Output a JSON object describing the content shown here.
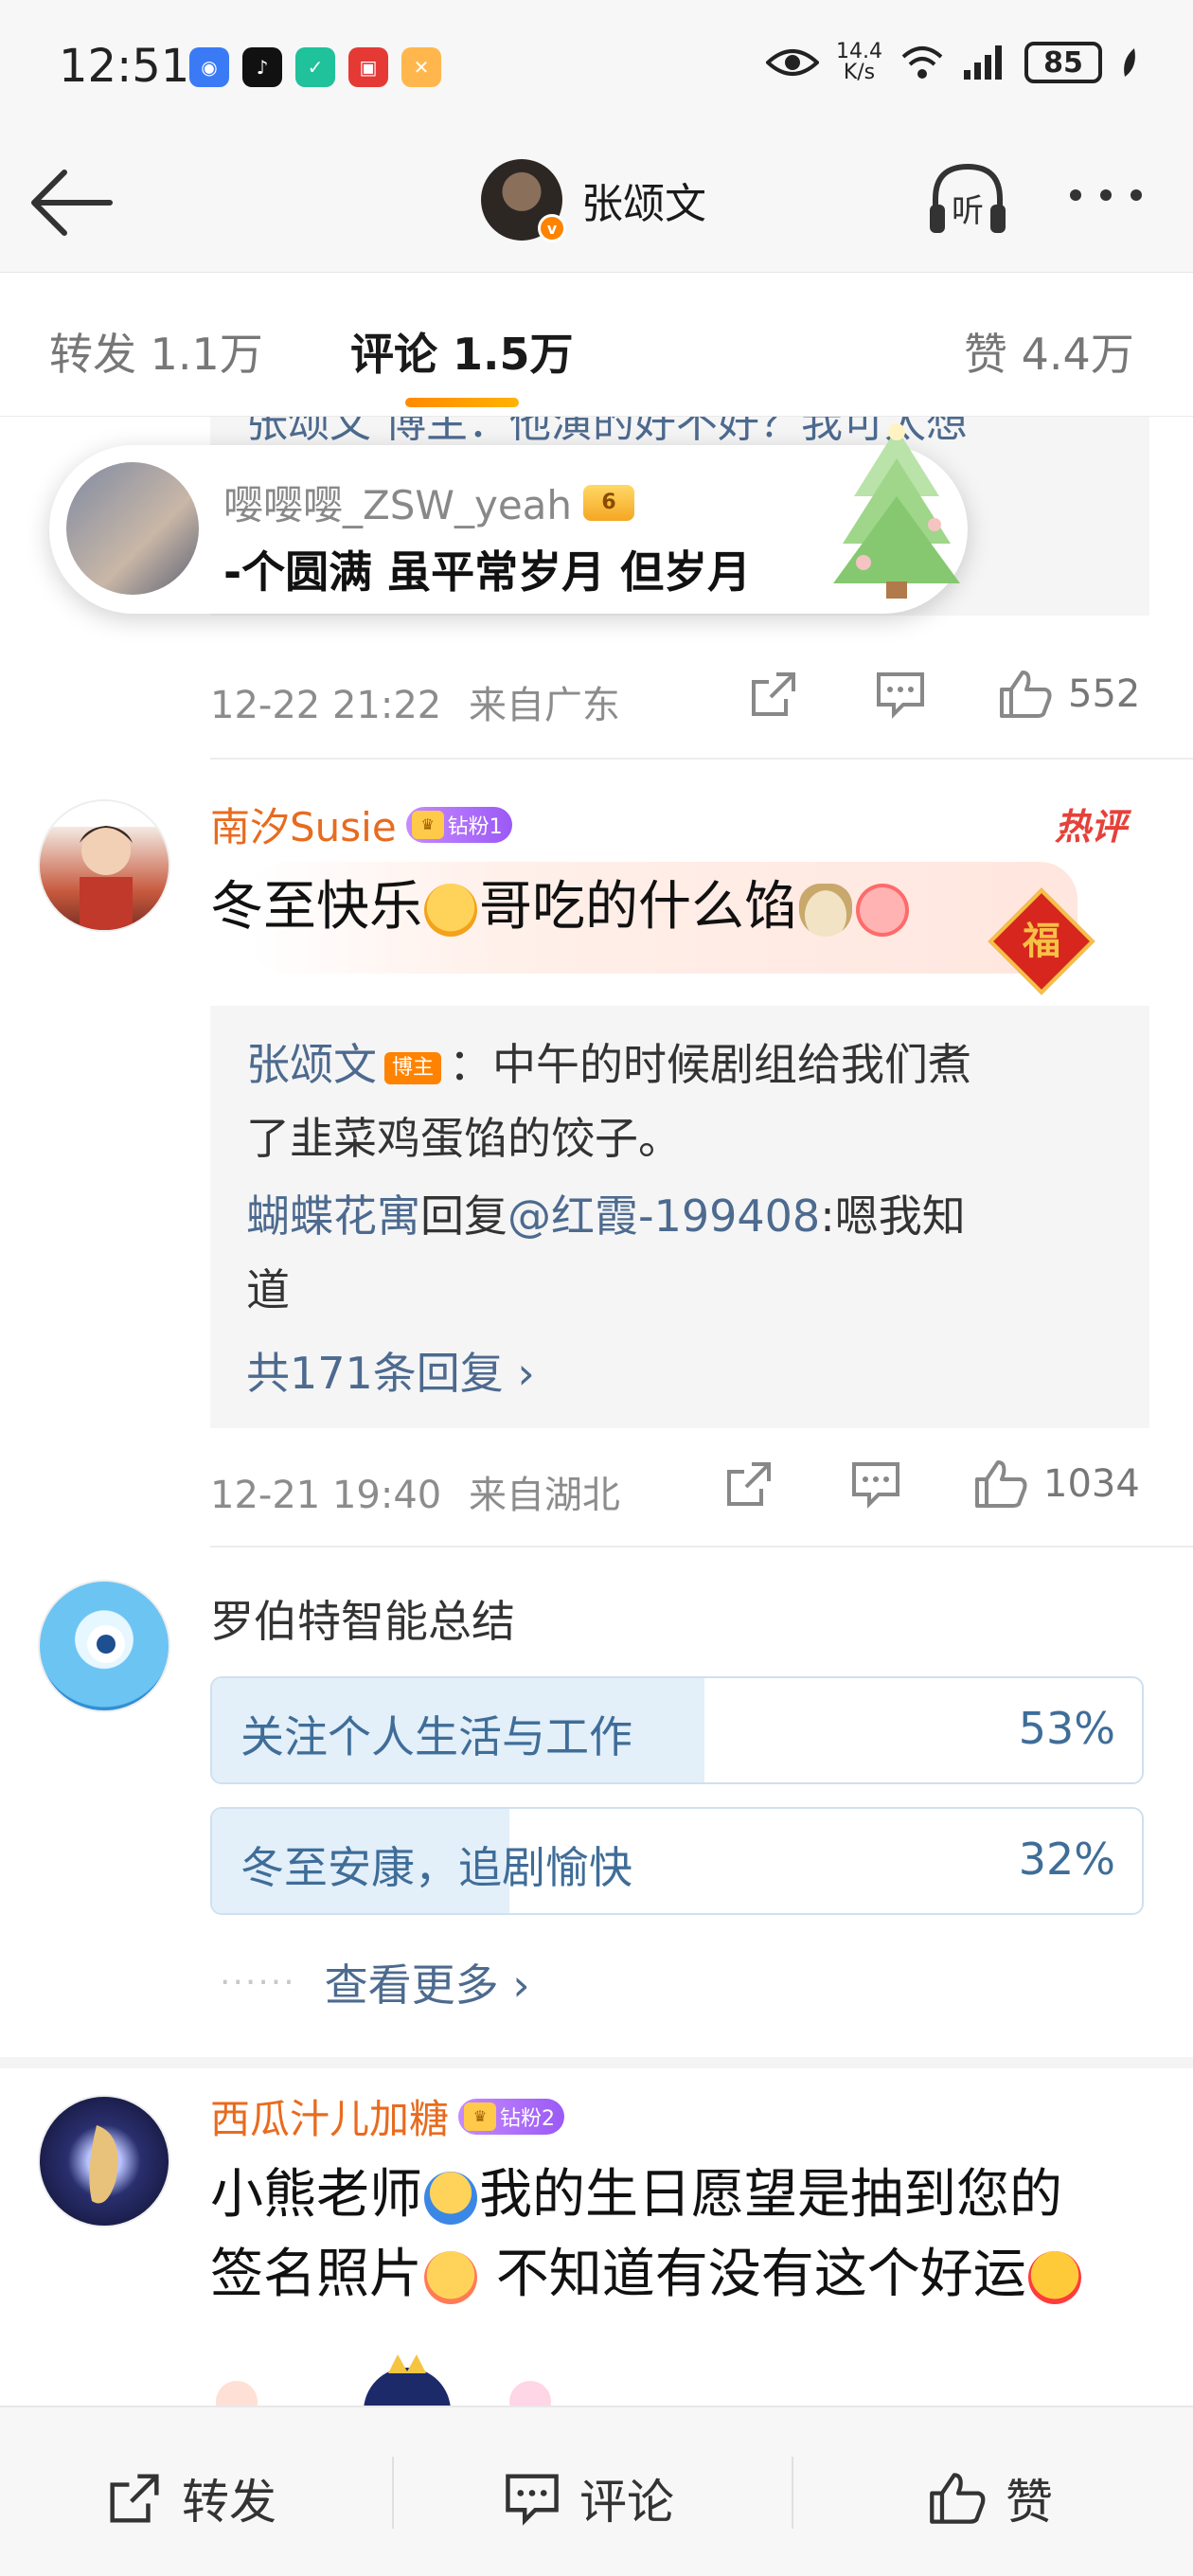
{
  "status_bar": {
    "time": "12:51",
    "net_speed_value": "14.4",
    "net_speed_unit": "K/s",
    "battery": "85"
  },
  "header": {
    "title": "张颂文",
    "listen_label": "听"
  },
  "tabs": [
    {
      "label": "转发 1.1万"
    },
    {
      "label": "评论 1.5万"
    },
    {
      "label": "赞 4.4万"
    }
  ],
  "top_reply_ghost": "张颂文 博主：他演的好不好？我可太想",
  "popup": {
    "user": "嘤嘤嘤_ZSW_yeah",
    "badge": "6",
    "text": "-个圆满 虽平常岁月 但岁月"
  },
  "comment0_meta": {
    "time": "12-22 21:22",
    "location": "来自广东",
    "likes": "552"
  },
  "comment1": {
    "user": "南汐Susie",
    "fan_badge": "钻粉1",
    "hot_label": "热评",
    "text_a": "冬至快乐",
    "text_b": "哥吃的什么馅",
    "fu_char": "福",
    "reply_author": "张颂文",
    "reply_author_badge": "博主",
    "reply_line1": "：中午的时候剧组给我们煮",
    "reply_line2": "了韭菜鸡蛋馅的饺子。",
    "reply2_user": "蝴蝶花寓",
    "reply2_mid": "回复",
    "reply2_target": "@红霞-199408",
    "reply2_text_a": ":嗯我知",
    "reply2_text_b": "道",
    "reply_count": "共171条回复 ›",
    "time": "12-21 19:40",
    "location": "来自湖北",
    "likes": "1034"
  },
  "ai_summary": {
    "title": "罗伯特智能总结",
    "options": [
      {
        "label": "关注个人生活与工作",
        "pct_text": "53%",
        "fraction": 0.53
      },
      {
        "label": "冬至安康，追剧愉快",
        "pct_text": "32%",
        "fraction": 0.32
      }
    ],
    "see_more": "查看更多 ›"
  },
  "comment2": {
    "user": "西瓜汁儿加糖",
    "fan_badge": "钻粉2",
    "text_a": "小熊老师",
    "text_b": "我的生日愿望是抽到您的",
    "text_c": "签名照片",
    "text_d": " 不知道有没有这个好运"
  },
  "bottom_bar": {
    "repost": "转发",
    "comment": "评论",
    "like": "赞"
  },
  "colors": {
    "accent": "#ff8200",
    "link_blue": "#4d6a8f",
    "username_orange": "#e86b1f"
  }
}
